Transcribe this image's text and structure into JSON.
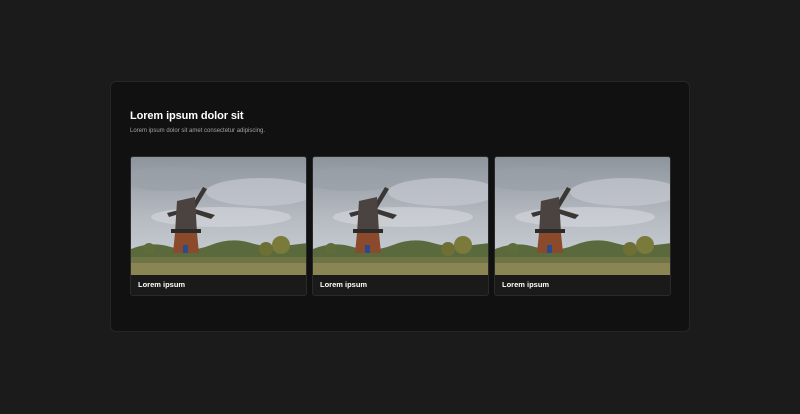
{
  "section": {
    "title": "Lorem ipsum dolor sit",
    "subtitle": "Lorem ipsum dolor sit amet consectetur adipiscing."
  },
  "cards": [
    {
      "label": "Lorem ipsum",
      "image": "windmill-photo"
    },
    {
      "label": "Lorem ipsum",
      "image": "windmill-photo"
    },
    {
      "label": "Lorem ipsum",
      "image": "windmill-photo"
    }
  ],
  "colors": {
    "page_background": "#1b1b1b",
    "panel_background": "#111111",
    "card_background": "#1a1a1a",
    "title_text": "#ffffff",
    "subtitle_text": "#a3a3a3"
  }
}
